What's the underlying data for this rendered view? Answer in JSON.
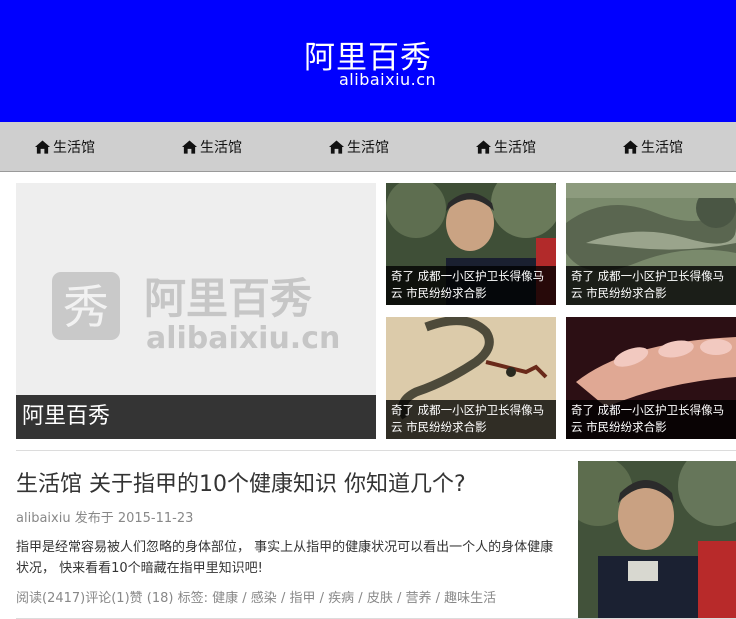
{
  "header": {
    "brand_cn": "阿里百秀",
    "brand_en": "alibaixiu.cn"
  },
  "nav": {
    "items": [
      {
        "label": "生活馆",
        "icon": "home-icon"
      },
      {
        "label": "生活馆",
        "icon": "home-icon"
      },
      {
        "label": "生活馆",
        "icon": "home-icon"
      },
      {
        "label": "生活馆",
        "icon": "home-icon"
      },
      {
        "label": "生活馆",
        "icon": "home-icon"
      }
    ]
  },
  "featured": {
    "big": {
      "caption": "阿里百秀",
      "logo_cn": "阿里百秀",
      "logo_en": "alibaixiu.cn",
      "logo_glyph": "秀"
    },
    "small": [
      {
        "caption": "奇了 成都一小区护卫长得像马云 市民纷纷求合影"
      },
      {
        "caption": "奇了 成都一小区护卫长得像马云 市民纷纷求合影"
      },
      {
        "caption": "奇了 成都一小区护卫长得像马云 市民纷纷求合影"
      },
      {
        "caption": "奇了 成都一小区护卫长得像马云 市民纷纷求合影"
      }
    ]
  },
  "article": {
    "title": "生活馆 关于指甲的10个健康知识 你知道几个?",
    "meta": "alibaixiu 发布于 2015-11-23",
    "excerpt": "指甲是经常容易被人们忽略的身体部位， 事实上从指甲的健康状况可以看出一个人的身体健康状况， 快来看看10个暗藏在指甲里知识吧!",
    "stats": "阅读(2417)评论(1)赞 (18) 标签:",
    "tags": [
      "健康",
      "感染",
      "指甲",
      "疾病",
      "皮肤",
      "营养",
      "趣味生活"
    ],
    "tag_separator": " / "
  },
  "colors": {
    "header_bg": "#0000ff",
    "nav_bg": "#cfcfcf",
    "caption_bg": "#000000"
  }
}
